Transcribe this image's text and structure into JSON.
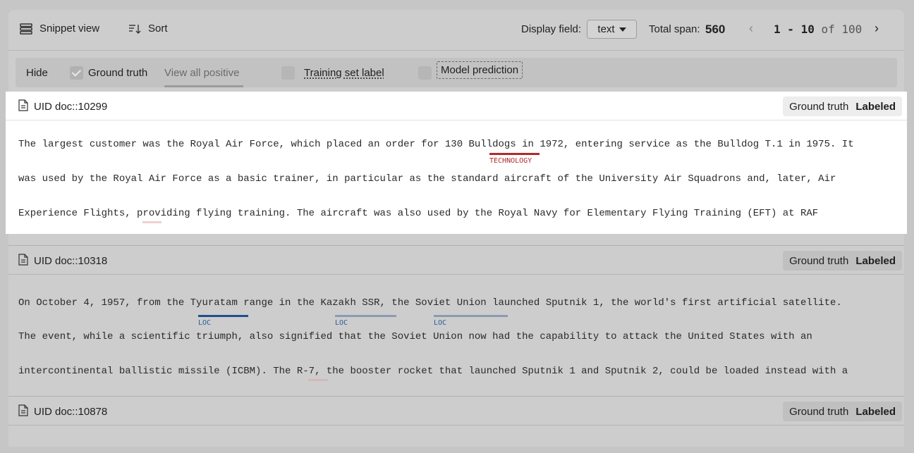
{
  "toolbar": {
    "snippet_view": "Snippet view",
    "sort": "Sort",
    "display_field_label": "Display field:",
    "display_field_value": "text",
    "total_span_label": "Total span:",
    "total_span_value": "560",
    "pager_prev": "‹",
    "pager_range_start": "1",
    "pager_dash": "-",
    "pager_range_end": "10",
    "pager_of": "of",
    "pager_total": "100",
    "pager_next": "›"
  },
  "filters": {
    "hide": "Hide",
    "ground_truth": "Ground truth",
    "ground_truth_checked": true,
    "view_all_positive": "View all positive",
    "training_set_label": "Training set label",
    "training_set_checked": false,
    "model_prediction": "Model prediction",
    "model_prediction_checked": false
  },
  "documents": [
    {
      "uid": "UID doc::10299",
      "badge_key": "Ground truth",
      "badge_value": "Labeled",
      "lines": [
        "The largest customer was the Royal Air Force, which placed an order for 130 Bulldogs in 1972, entering service as the Bulldog T.1 in 1975. It",
        "was used by the Royal Air Force as a basic trainer, in particular as the standard aircraft of the University Air Squadrons and, later, Air",
        "Experience Flights, providing flying training. The aircraft was also used by the Royal Navy for Elementary Flying Training (EFT) at RAF"
      ],
      "entities": [
        {
          "label": "TECHNOLOGY",
          "color": "#b22a2a"
        }
      ]
    },
    {
      "uid": "UID doc::10318",
      "badge_key": "Ground truth",
      "badge_value": "Labeled",
      "lines": [
        "On October 4, 1957, from the Tyuratam range in the Kazakh SSR, the Soviet Union launched Sputnik 1, the world's first artificial satellite.",
        "The event, while a scientific triumph, also signified that the Soviet Union now had the capability to attack the United States with an",
        "intercontinental ballistic missile (ICBM). The R-7, the booster rocket that launched Sputnik 1 and Sputnik 2, could be loaded instead with a"
      ],
      "entities": [
        {
          "label": "LOC",
          "color": "#2a5a9a"
        },
        {
          "label": "LOC",
          "color": "#2a5a9a"
        },
        {
          "label": "LOC",
          "color": "#2a5a9a"
        }
      ]
    },
    {
      "uid": "UID doc::10878",
      "badge_key": "Ground truth",
      "badge_value": "Labeled"
    }
  ]
}
